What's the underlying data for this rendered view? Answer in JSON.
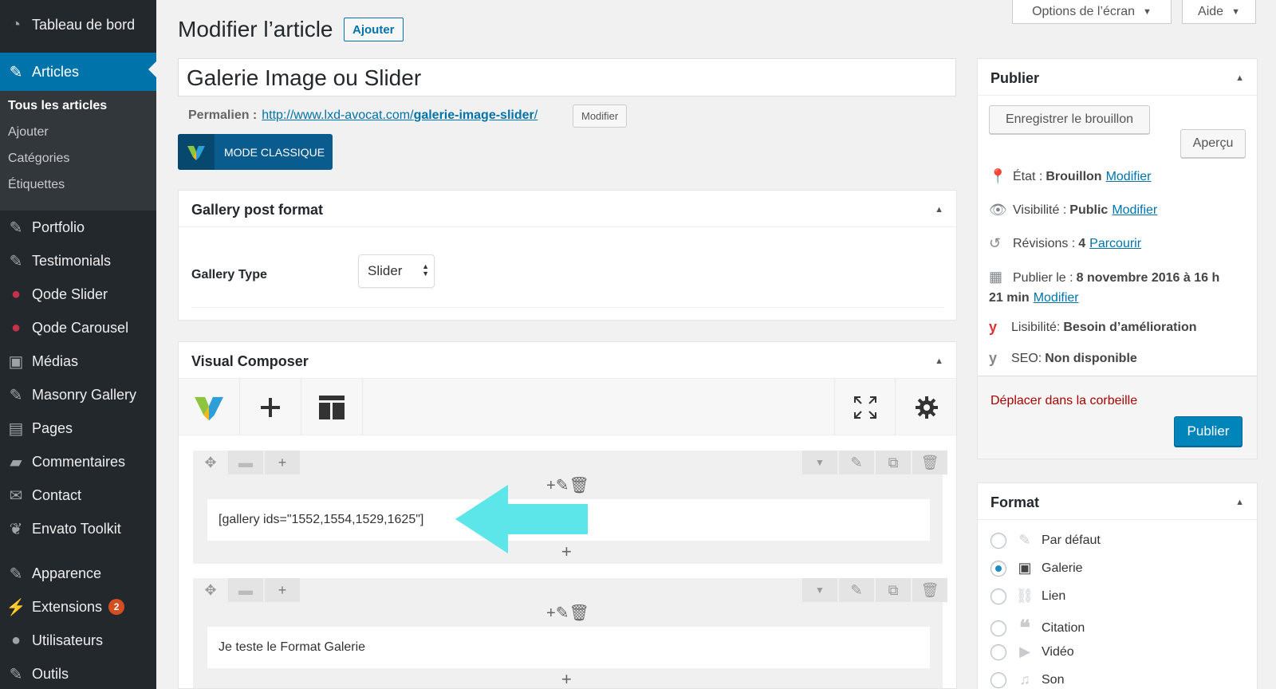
{
  "sidebar": {
    "dashboard": "Tableau de bord",
    "posts": "Articles",
    "sub": [
      "Tous les articles",
      "Ajouter",
      "Catégories",
      "Étiquettes"
    ],
    "items": [
      "Portfolio",
      "Testimonials",
      "Qode Slider",
      "Qode Carousel",
      "Médias",
      "Masonry Gallery",
      "Pages",
      "Commentaires",
      "Contact",
      "Envato Toolkit"
    ],
    "items2": [
      "Apparence",
      "Extensions",
      "Utilisateurs",
      "Outils"
    ],
    "extensions_badge": "2"
  },
  "top": {
    "screen_options": "Options de l’écran",
    "help": "Aide"
  },
  "header": {
    "title": "Modifier l’article",
    "add_new": "Ajouter"
  },
  "post": {
    "title": "Galerie Image ou Slider",
    "permalink_label": "Permalien :",
    "permalink_base": "http://www.lxd-avocat.com/",
    "permalink_slug": "galerie-image-slider",
    "permalink_end": "/",
    "permalink_edit": "Modifier",
    "classic_mode": "MODE CLASSIQUE"
  },
  "gallery_box": {
    "title": "Gallery post format",
    "type_label": "Gallery Type",
    "type_value": "Slider"
  },
  "vc": {
    "title": "Visual Composer",
    "row1_text": "[gallery ids=\"1552,1554,1529,1625\"]",
    "row2_text": "Je teste le Format Galerie"
  },
  "publish": {
    "title": "Publier",
    "save_draft": "Enregistrer le brouillon",
    "preview": "Aperçu",
    "status_label": "État :",
    "status_value": "Brouillon",
    "visibility_label": "Visibilité :",
    "visibility_value": "Public",
    "revisions_label": "Révisions :",
    "revisions_value": "4",
    "browse": "Parcourir",
    "publish_on_label": "Publier le :",
    "publish_on_value1": "8 novembre 2016 à 16 h",
    "publish_on_value2": "21 min",
    "edit": "Modifier",
    "readability_label": "Lisibilité:",
    "readability_value": "Besoin d’amélioration",
    "seo_label": "SEO:",
    "seo_value": "Non disponible",
    "trash": "Déplacer dans la corbeille",
    "publish_btn": "Publier"
  },
  "format": {
    "title": "Format",
    "options": [
      "Par défaut",
      "Galerie",
      "Lien",
      "Citation",
      "Vidéo",
      "Son"
    ],
    "selected": "Galerie"
  },
  "colors": {
    "admin_bar": "#23282d",
    "accent": "#0073aa",
    "arrow": "#5de6ea",
    "danger": "#aa0000"
  }
}
